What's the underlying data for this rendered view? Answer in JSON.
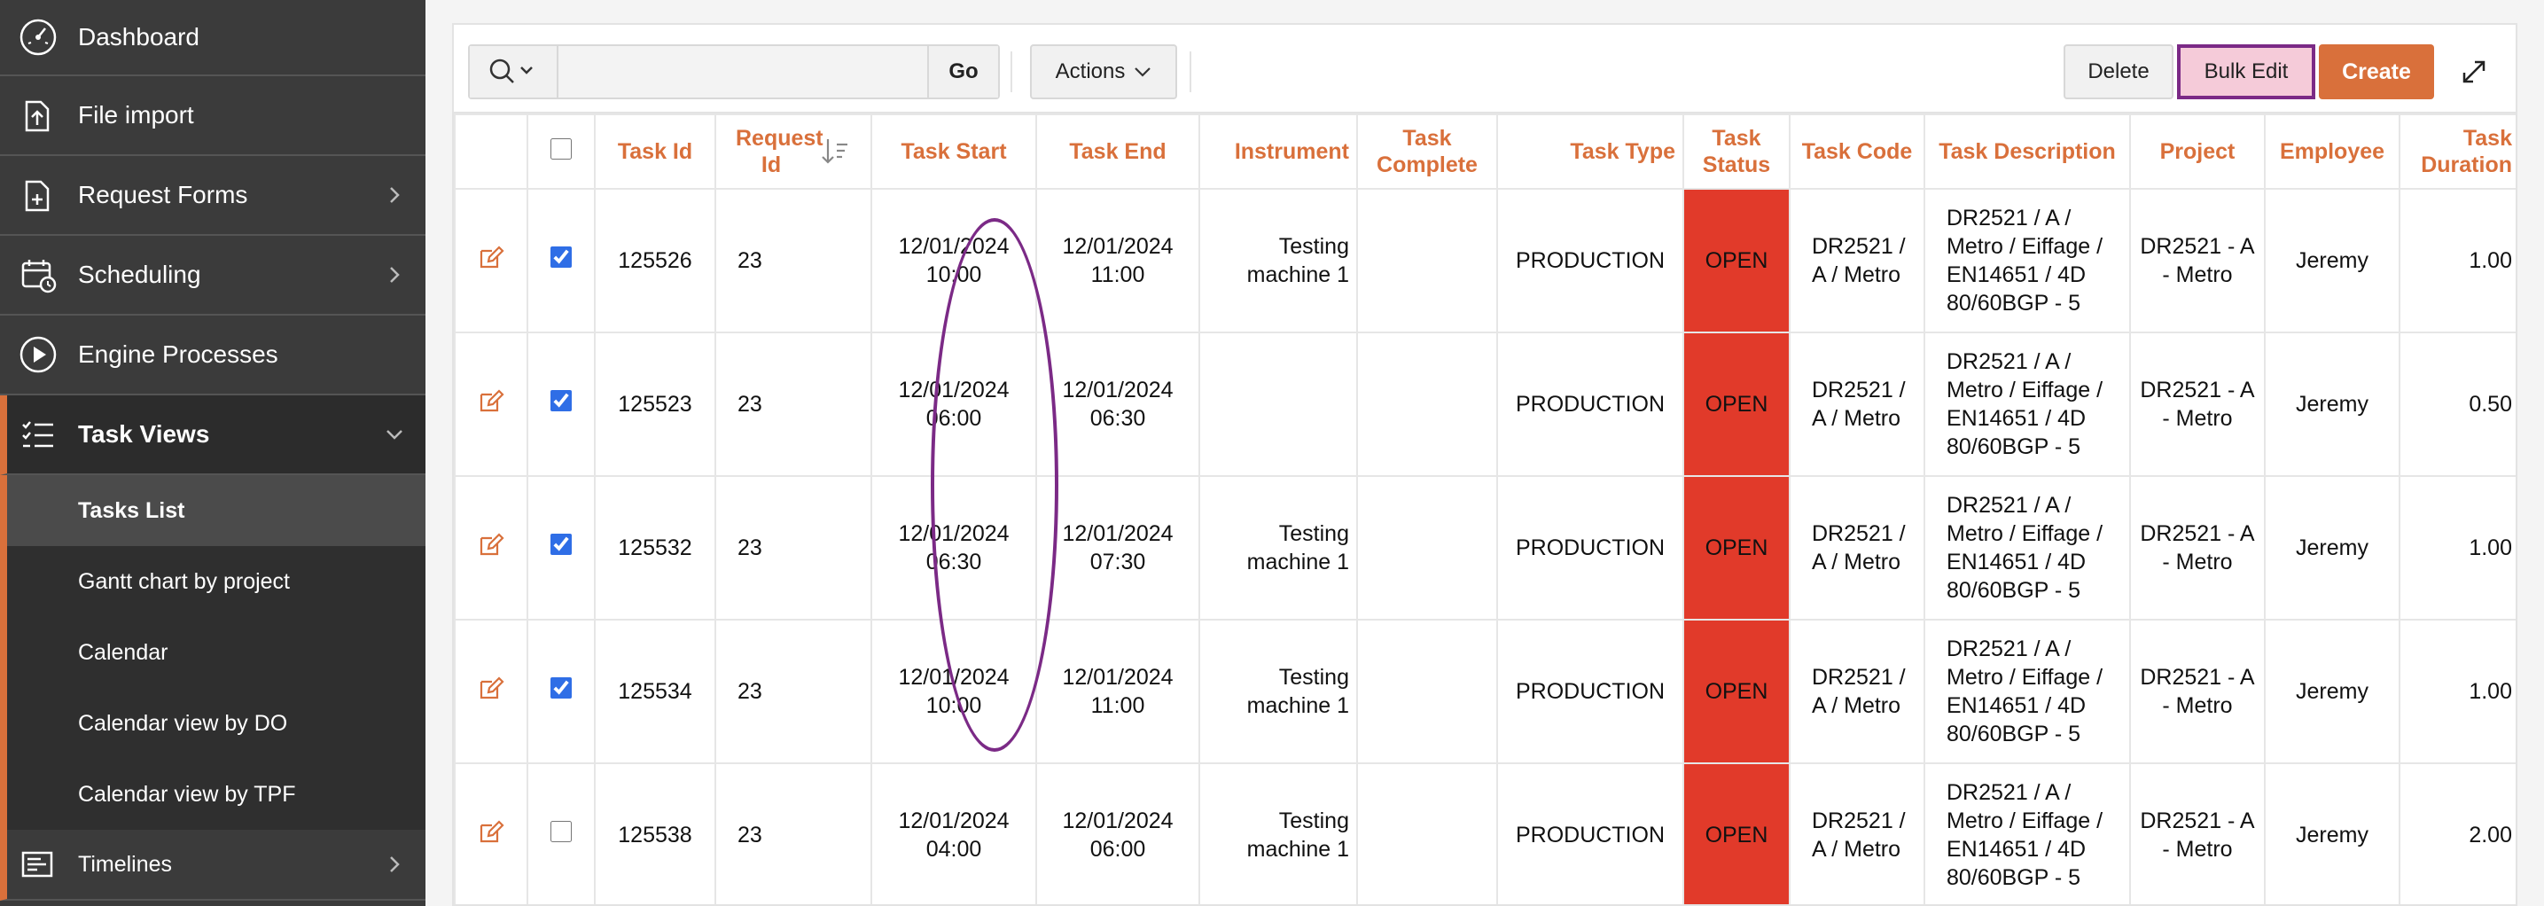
{
  "sidebar": {
    "items": [
      {
        "label": "Dashboard",
        "icon": "gauge-icon",
        "has_children": false
      },
      {
        "label": "File import",
        "icon": "file-upload-icon",
        "has_children": false
      },
      {
        "label": "Request Forms",
        "icon": "file-add-icon",
        "has_children": true
      },
      {
        "label": "Scheduling",
        "icon": "calendar-clock-icon",
        "has_children": true
      },
      {
        "label": "Engine Processes",
        "icon": "play-circle-icon",
        "has_children": false
      },
      {
        "label": "Task Views",
        "icon": "checklist-icon",
        "has_children": true,
        "expanded": true
      }
    ],
    "task_views_children": [
      {
        "label": "Tasks List",
        "current": true
      },
      {
        "label": "Gantt chart by project"
      },
      {
        "label": "Calendar"
      },
      {
        "label": "Calendar view by DO"
      },
      {
        "label": "Calendar view by TPF"
      }
    ],
    "timelines": {
      "label": "Timelines",
      "icon": "timeline-icon",
      "has_children": true
    }
  },
  "toolbar": {
    "search_placeholder": "",
    "search_value": "",
    "go_label": "Go",
    "actions_label": "Actions",
    "delete_label": "Delete",
    "bulk_edit_label": "Bulk Edit",
    "create_label": "Create"
  },
  "table": {
    "headers": {
      "task_id": "Task Id",
      "request_id": "Request Id",
      "task_start": "Task Start",
      "task_end": "Task End",
      "instrument": "Instrument",
      "task_complete": "Task Complete",
      "task_type": "Task Type",
      "task_status": "Task Status",
      "task_code": "Task Code",
      "task_description": "Task Description",
      "project": "Project",
      "employee": "Employee",
      "task_duration": "Task Duration"
    },
    "rows": [
      {
        "checked": true,
        "task_id": "125526",
        "request_id": "23",
        "task_start": "12/01/2024 10:00",
        "task_end": "12/01/2024 11:00",
        "instrument": "Testing machine 1",
        "task_complete": "",
        "task_type": "PRODUCTION",
        "task_status": "OPEN",
        "task_code": "DR2521 / A / Metro",
        "task_description": "DR2521 / A / Metro / Eiffage / EN14651 / 4D 80/60BGP - 5",
        "project": "DR2521 - A - Metro",
        "employee": "Jeremy",
        "task_duration": "1.00"
      },
      {
        "checked": true,
        "task_id": "125523",
        "request_id": "23",
        "task_start": "12/01/2024 06:00",
        "task_end": "12/01/2024 06:30",
        "instrument": "",
        "task_complete": "",
        "task_type": "PRODUCTION",
        "task_status": "OPEN",
        "task_code": "DR2521 / A / Metro",
        "task_description": "DR2521 / A / Metro / Eiffage / EN14651 / 4D 80/60BGP - 5",
        "project": "DR2521 - A - Metro",
        "employee": "Jeremy",
        "task_duration": "0.50"
      },
      {
        "checked": true,
        "task_id": "125532",
        "request_id": "23",
        "task_start": "12/01/2024 06:30",
        "task_end": "12/01/2024 07:30",
        "instrument": "Testing machine 1",
        "task_complete": "",
        "task_type": "PRODUCTION",
        "task_status": "OPEN",
        "task_code": "DR2521 / A / Metro",
        "task_description": "DR2521 / A / Metro / Eiffage / EN14651 / 4D 80/60BGP - 5",
        "project": "DR2521 - A - Metro",
        "employee": "Jeremy",
        "task_duration": "1.00"
      },
      {
        "checked": true,
        "task_id": "125534",
        "request_id": "23",
        "task_start": "12/01/2024 10:00",
        "task_end": "12/01/2024 11:00",
        "instrument": "Testing machine 1",
        "task_complete": "",
        "task_type": "PRODUCTION",
        "task_status": "OPEN",
        "task_code": "DR2521 / A / Metro",
        "task_description": "DR2521 / A / Metro / Eiffage / EN14651 / 4D 80/60BGP - 5",
        "project": "DR2521 - A - Metro",
        "employee": "Jeremy",
        "task_duration": "1.00"
      },
      {
        "checked": false,
        "task_id": "125538",
        "request_id": "23",
        "task_start": "12/01/2024 04:00",
        "task_end": "12/01/2024 06:00",
        "instrument": "Testing machine 1",
        "task_complete": "",
        "task_type": "PRODUCTION",
        "task_status": "OPEN",
        "task_code": "DR2521 / A / Metro",
        "task_description": "DR2521 / A / Metro / Eiffage / EN14651 / 4D 80/60BGP - 5",
        "project": "DR2521 - A - Metro",
        "employee": "Jeremy",
        "task_duration": "2.00"
      }
    ]
  },
  "colors": {
    "accent": "#d9703b",
    "status_open": "#e13a2a",
    "highlight": "#7b2a86",
    "sidebar_bg": "#3b3b3b"
  }
}
